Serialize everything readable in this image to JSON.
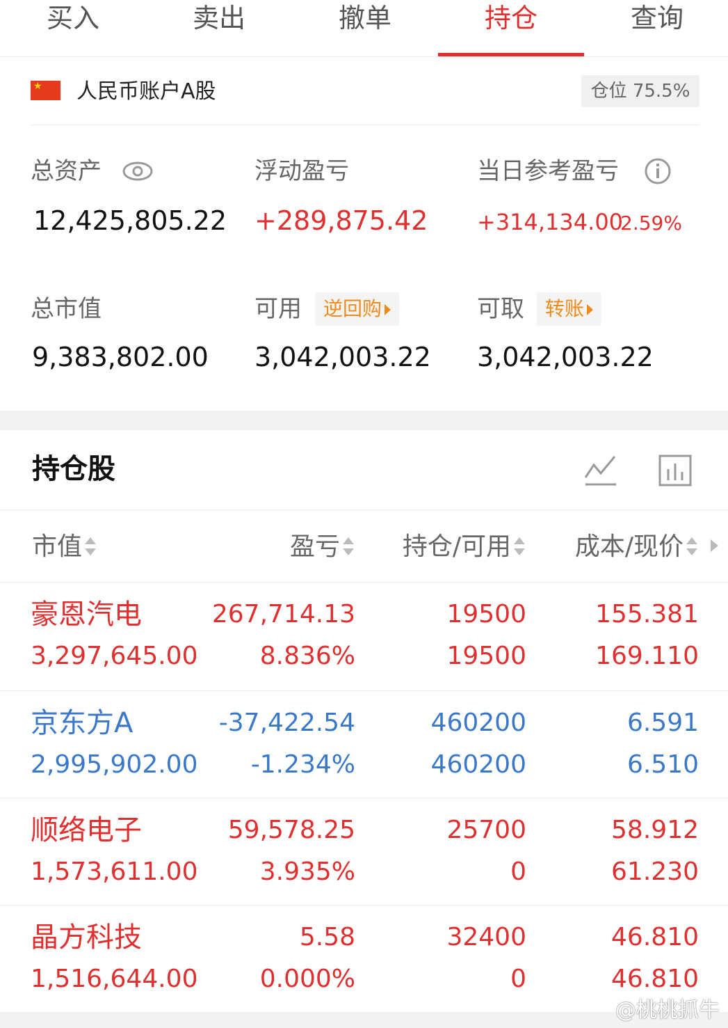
{
  "tabs": [
    {
      "label": "买入"
    },
    {
      "label": "卖出"
    },
    {
      "label": "撤单"
    },
    {
      "label": "持仓"
    },
    {
      "label": "查询"
    }
  ],
  "active_tab": "持仓",
  "account": {
    "name": "人民币账户A股",
    "position_label": "仓位 75.5%"
  },
  "summary": {
    "total_assets_label": "总资产",
    "total_assets": "12,425,805.22",
    "floating_pl_label": "浮动盈亏",
    "floating_pl": "+289,875.42",
    "daily_pl_label": "当日参考盈亏",
    "daily_pl": "+314,134.00",
    "daily_pl_pct": "2.59%",
    "market_value_label": "总市值",
    "market_value": "9,383,802.00",
    "available_label": "可用",
    "available_pill": "逆回购",
    "available": "3,042,003.22",
    "withdrawable_label": "可取",
    "withdrawable_pill": "转账",
    "withdrawable": "3,042,003.22"
  },
  "holdings": {
    "title": "持仓股",
    "columns": [
      "市值",
      "盈亏",
      "持仓/可用",
      "成本/现价"
    ],
    "rows": [
      {
        "name": "豪恩汽电",
        "market_value": "3,297,645.00",
        "pl": "267,714.13",
        "pl_pct": "8.836%",
        "position": "19500",
        "available": "19500",
        "cost": "155.381",
        "price": "169.110",
        "trend": "up"
      },
      {
        "name": "京东方A",
        "market_value": "2,995,902.00",
        "pl": "-37,422.54",
        "pl_pct": "-1.234%",
        "position": "460200",
        "available": "460200",
        "cost": "6.591",
        "price": "6.510",
        "trend": "down"
      },
      {
        "name": "顺络电子",
        "market_value": "1,573,611.00",
        "pl": "59,578.25",
        "pl_pct": "3.935%",
        "position": "25700",
        "available": "0",
        "cost": "58.912",
        "price": "61.230",
        "trend": "up"
      },
      {
        "name": "晶方科技",
        "market_value": "1,516,644.00",
        "pl": "5.58",
        "pl_pct": "0.000%",
        "position": "32400",
        "available": "0",
        "cost": "46.810",
        "price": "46.810",
        "trend": "up"
      }
    ]
  },
  "watermark": "@桃桃抓牛",
  "colors": {
    "red": "#e02f2f",
    "blue": "#3a78c9",
    "orange": "#f08a1c"
  }
}
